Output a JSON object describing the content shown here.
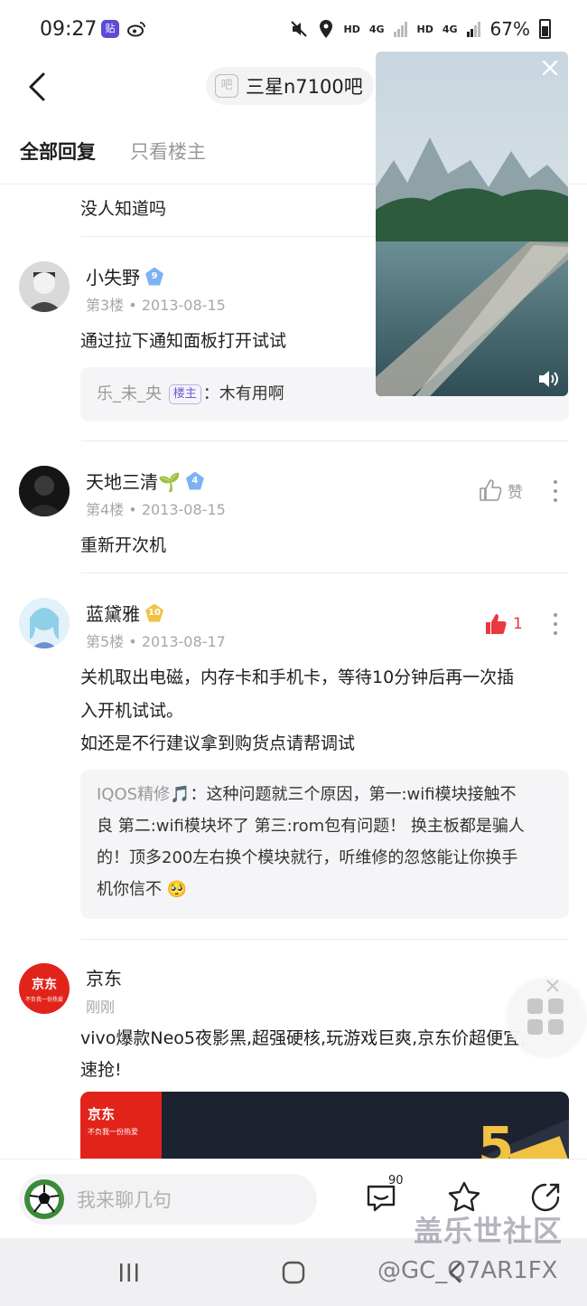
{
  "status_bar": {
    "time": "09:27",
    "left_icons": [
      "tieba-icon",
      "weibo-icon"
    ],
    "hd1": "HD",
    "net1": "4G",
    "hd2": "HD",
    "net2": "4G",
    "battery": "67%"
  },
  "header": {
    "forum_name": "三星n7100吧",
    "forum_icon_text": "吧"
  },
  "tabs": [
    {
      "label": "全部回复",
      "active": true
    },
    {
      "label": "只看楼主",
      "active": false
    }
  ],
  "posts": [
    {
      "text": "没人知道吗"
    },
    {
      "user": "小失野",
      "level": "9",
      "floor": "第3楼",
      "date": "2013-08-15",
      "text": "通过拉下通知面板打开试试",
      "reply": {
        "name": "乐_未_央",
        "badge": "楼主",
        "text": "：木有用啊"
      }
    },
    {
      "user": "天地三清🌱",
      "level": "4",
      "floor": "第4楼",
      "date": "2013-08-15",
      "text": "重新开次机",
      "like_label": "赞"
    },
    {
      "user": "蓝黛雅",
      "level": "10",
      "floor": "第5楼",
      "date": "2013-08-17",
      "text_lines": [
        "关机取出电磁，内存卡和手机卡，等待10分钟后再一次插",
        "入开机试试。",
        "如还是不行建议拿到购货点请帮调试"
      ],
      "like_count": "1",
      "reply": {
        "name": "IQOS精修🎵",
        "lines": [
          "：这种问题就三个原因，第一:wifi模块接触不",
          "良 第二:wifi模块坏了 第三:rom包有问题！ 换主板都是骗人",
          "的！顶多200左右换个模块就行，听维修的忽悠能让你换手",
          "机你信不 🥺"
        ]
      }
    }
  ],
  "ad": {
    "brand": "京东",
    "time": "刚刚",
    "badge_text": "京东",
    "badge_sub": "不负我一份热爱",
    "text_lines": [
      "vivo爆款Neo5夜影黑,超强硬核,玩游戏巨爽,京东价超便宜,",
      "速抢!"
    ],
    "banner_number": "5"
  },
  "bottom_bar": {
    "input_placeholder": "我来聊几句",
    "comment_count": "90"
  },
  "watermark": {
    "line1": "盖乐世社区",
    "line2": "@GC_Q7AR1FX"
  }
}
